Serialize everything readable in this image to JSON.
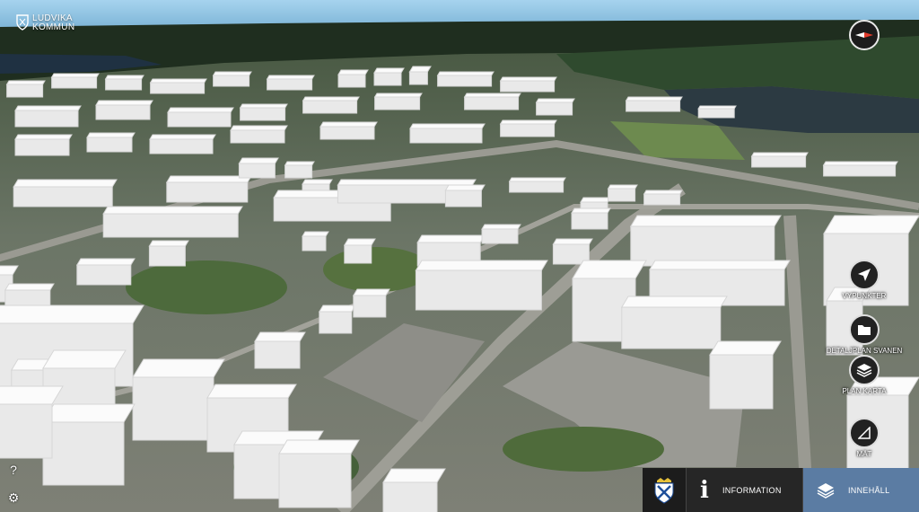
{
  "brand": {
    "line1": "LUDVIKA",
    "line2": "KOMMUN"
  },
  "compass": {
    "icon": "compass-icon"
  },
  "tools": [
    {
      "id": "vypunkter",
      "label": "VYPUNKTER",
      "icon": "navigation-arrow-icon"
    },
    {
      "id": "detaljplan",
      "label": "DETALJPLAN SVANEN",
      "icon": "folder-icon"
    },
    {
      "id": "plankarta",
      "label": "PLAN KARTA",
      "icon": "layers-icon"
    },
    {
      "id": "mat",
      "label": "MÄT",
      "icon": "measure-icon"
    }
  ],
  "side": {
    "help": "?",
    "settings": "⚙"
  },
  "bottom": {
    "information": "INFORMATION",
    "innehall": "INNEHÅLL"
  },
  "colors": {
    "sky": "#8fc4e4",
    "accent": "#5b7ca3",
    "panel": "#262626"
  }
}
